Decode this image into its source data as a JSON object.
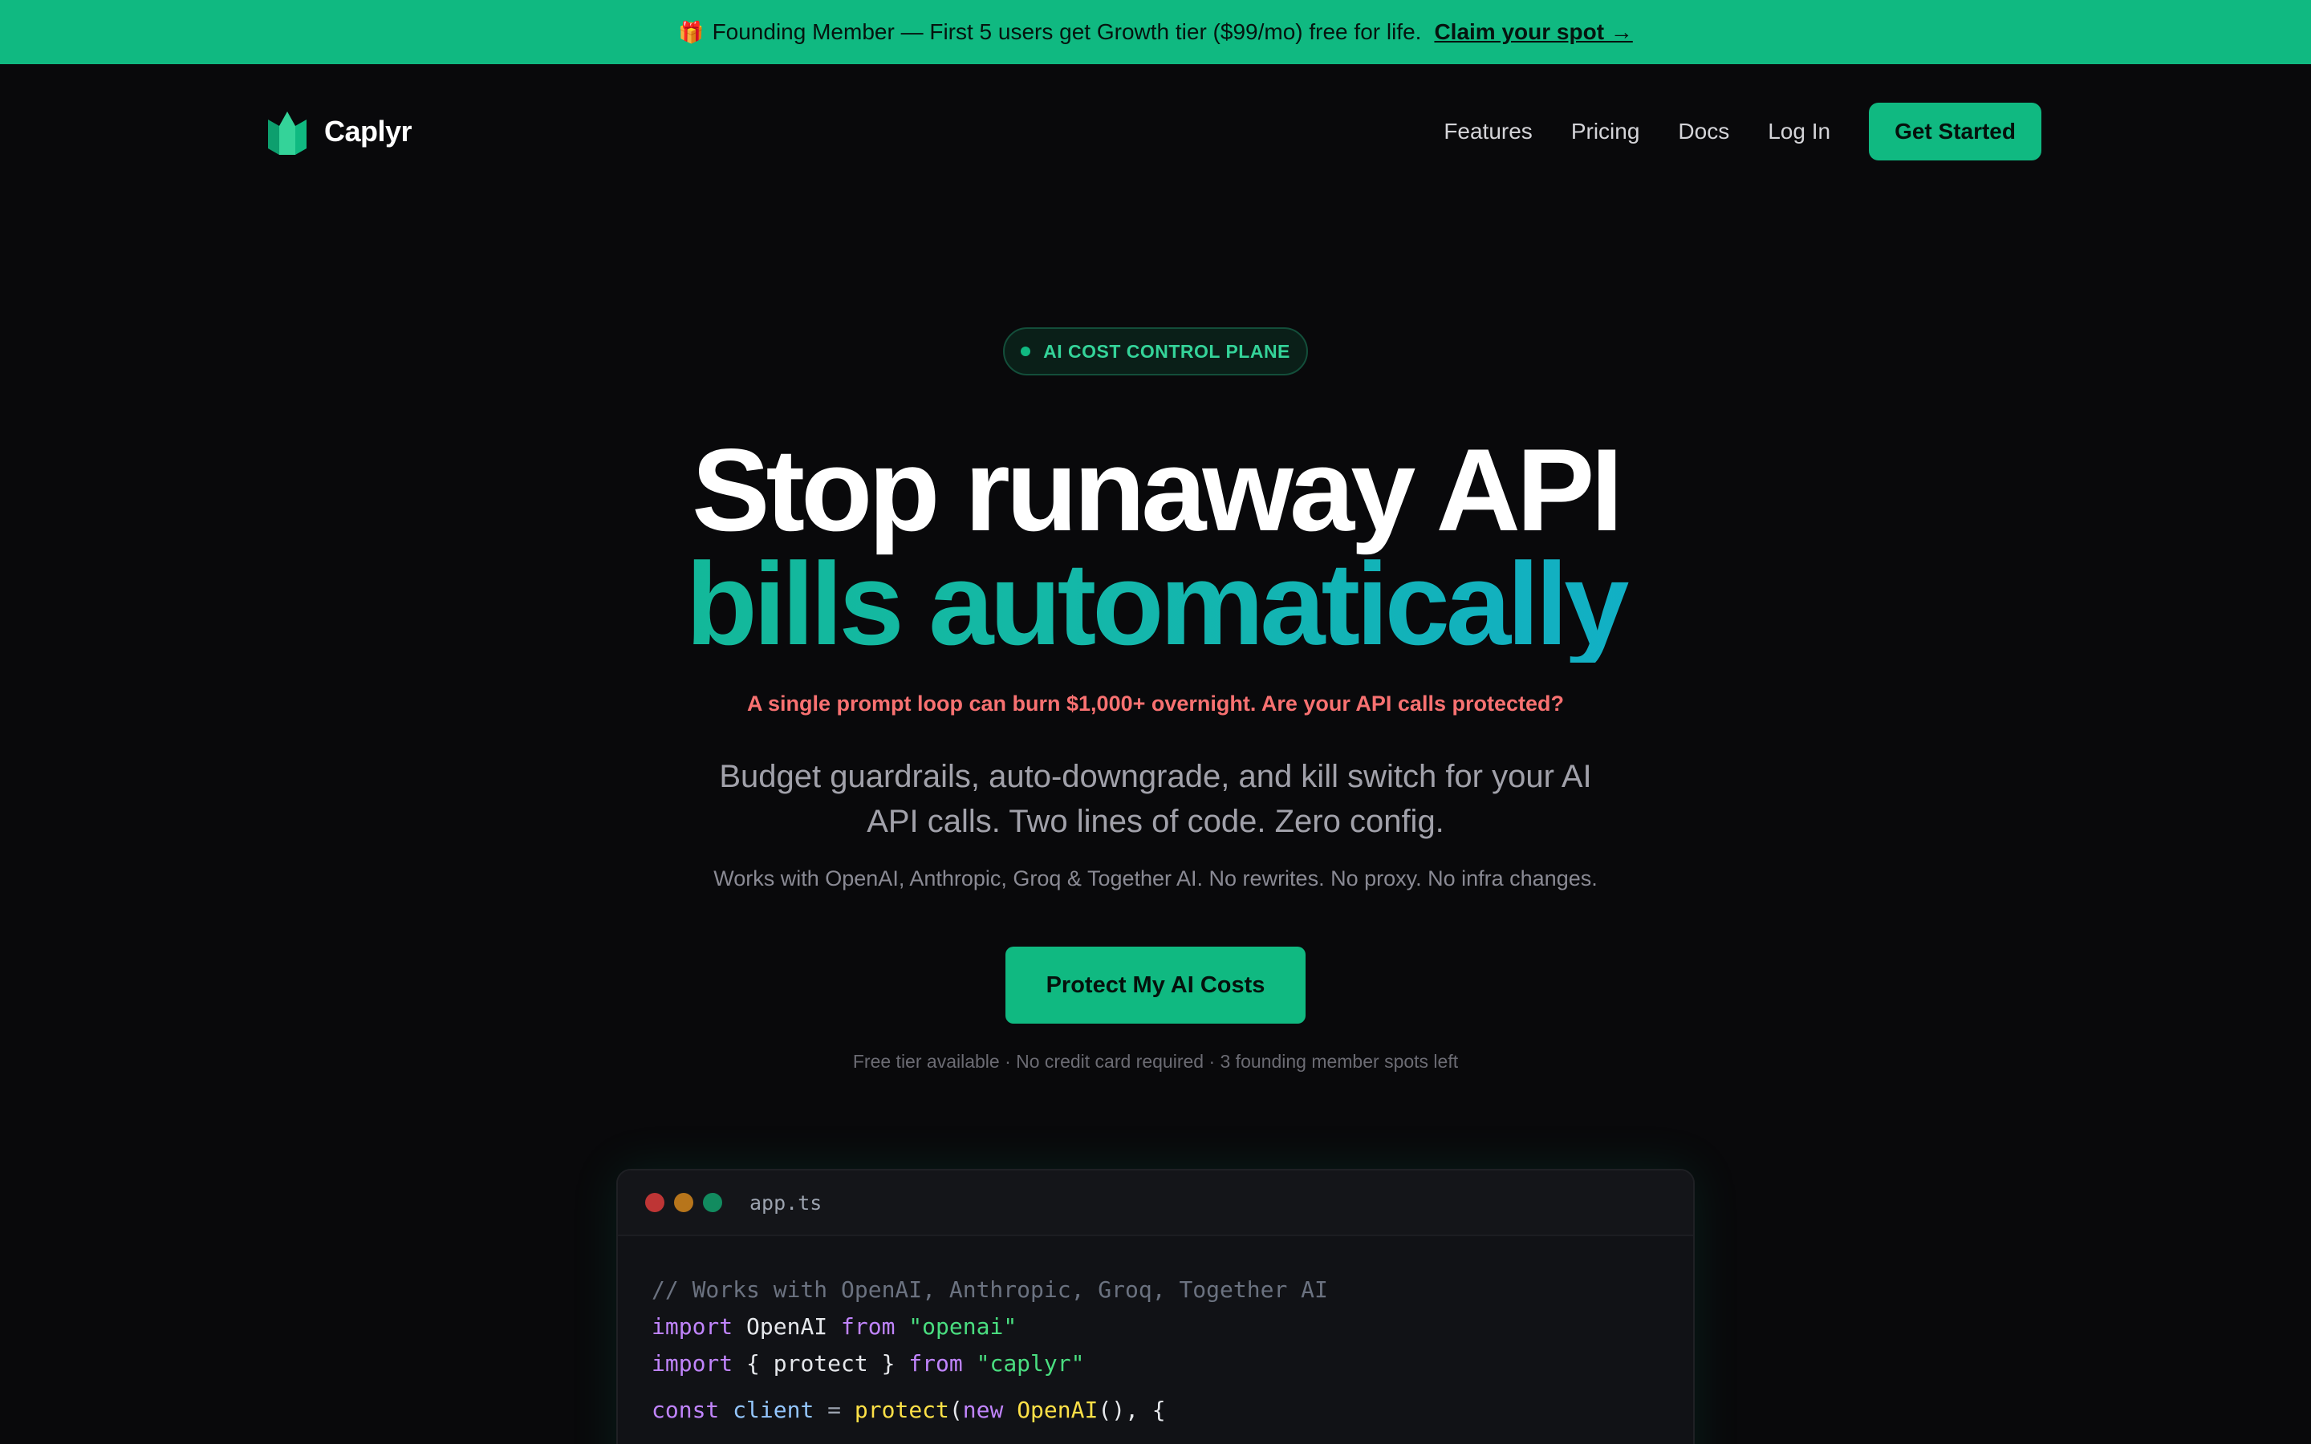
{
  "announcement": {
    "gift_icon": "gift-icon",
    "text": "Founding Member — First 5 users get Growth tier ($99/mo) free for life.",
    "link": "Claim your spot →"
  },
  "nav": {
    "logo_icon": "caplyr-logo",
    "brand": "Caplyr",
    "links": [
      "Features",
      "Pricing",
      "Docs",
      "Log In"
    ],
    "cta": "Get Started"
  },
  "hero": {
    "badge": "AI COST CONTROL PLANE",
    "title_line1": "Stop runaway API",
    "title_line2": "bills automatically",
    "warning": "A single prompt loop can burn $1,000+ overnight. Are your API calls protected?",
    "subhead": "Budget guardrails, auto-downgrade, and kill switch for your AI API calls. Two lines of code. Zero config.",
    "works_with": "Works with OpenAI, Anthropic, Groq & Together AI. No rewrites. No proxy. No infra changes.",
    "cta": "Protect My AI Costs",
    "fineprint": "Free tier available · No credit card required · 3 founding member spots left"
  },
  "code_window": {
    "filename": "app.ts",
    "comment": "// Works with OpenAI, Anthropic, Groq, Together AI",
    "line2": {
      "kw1": "import",
      "id": " OpenAI ",
      "kw2": "from",
      "str": " \"openai\""
    },
    "line3": {
      "kw1": "import",
      "id": " { protect } ",
      "kw2": "from",
      "str": " \"caplyr\""
    },
    "line4": {
      "kw1": "const",
      "var": " client",
      "op": " = ",
      "fn": "protect",
      "p1": "(",
      "kw2": "new",
      "cls": " OpenAI",
      "rest": "(), {"
    }
  },
  "colors": {
    "accent": "#10b981",
    "background": "#09090b",
    "warning": "#f87171",
    "gradient_start": "#10b981",
    "gradient_end": "#0ea5e9"
  }
}
